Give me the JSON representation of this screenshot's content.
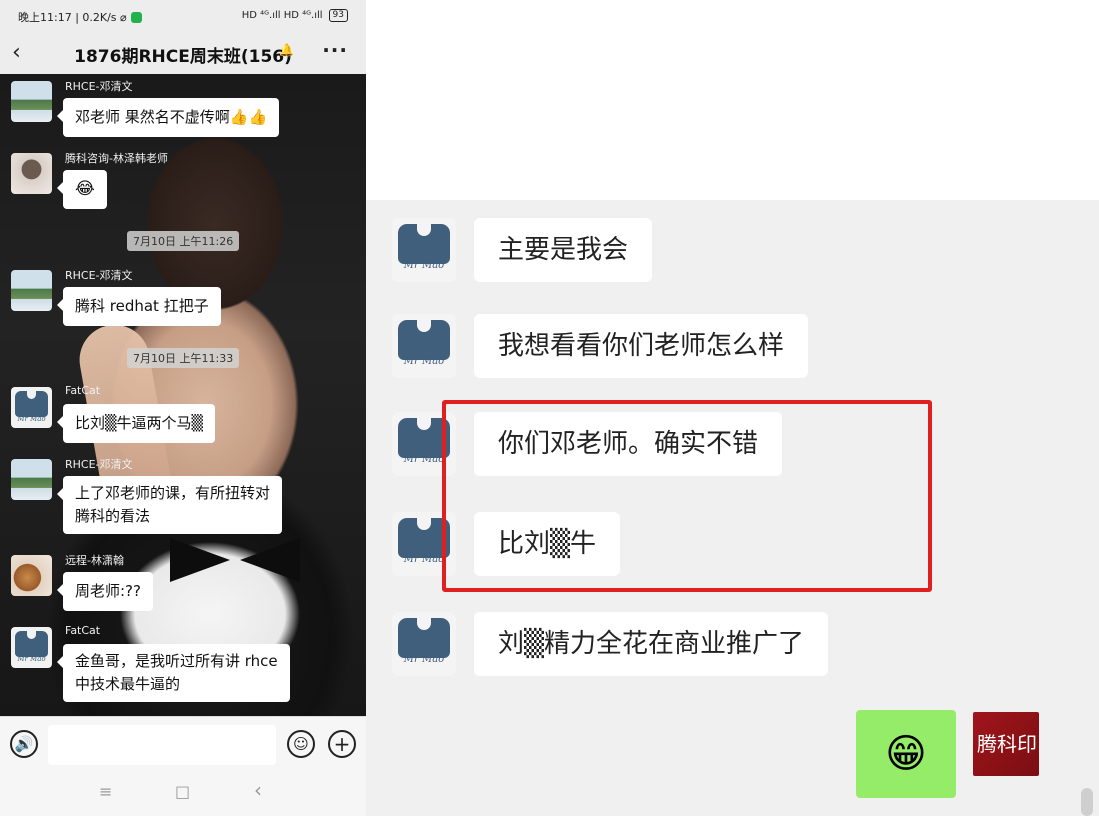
{
  "status_bar": {
    "time_speed": "晚上11:17 | 0.2K/s ⌀",
    "signals": "HD ⁴ᴳ.ıll HD ⁴ᴳ.ıll",
    "battery": "93"
  },
  "header": {
    "title": "1876期RHCE周末班(156)",
    "back_icon": "‹",
    "mute_icon": "🔔",
    "more_icon": "···"
  },
  "left_chat": {
    "messages": [
      {
        "sender": "RHCE-邓清文",
        "text": "邓老师 果然名不虚传啊👍👍"
      },
      {
        "sender": "腾科咨询-林泽韩老师",
        "text": "😂"
      },
      {
        "sender": "RHCE-邓清文",
        "text": "腾科 redhat 扛把子"
      },
      {
        "sender": "FatCat",
        "text": "比刘▒牛逼两个马▒"
      },
      {
        "sender": "RHCE-邓清文",
        "text": "上了邓老师的课，有所扭转对",
        "text2": "腾科的看法"
      },
      {
        "sender": "远程-林潇翰",
        "text": "周老师:??"
      },
      {
        "sender": "FatCat",
        "text": "金鱼哥，是我听过所有讲 rhce",
        "text2": "中技术最牛逼的"
      }
    ],
    "timestamps": [
      "7月10日 上午11:26",
      "7月10日 上午11:33"
    ],
    "avatar_caption": "Mr Mao"
  },
  "input_bar": {
    "voice_icon": "🔊",
    "emoji_icon": "☺",
    "plus_icon": "+"
  },
  "nav_bar": {
    "menu_icon": "≡",
    "home_icon": "□",
    "back_icon": "‹"
  },
  "zoom_chat": {
    "messages": [
      "主要是我会",
      "我想看看你们老师怎么样",
      "你们邓老师。确实不错",
      "比刘▒牛",
      "刘▒精力全花在商业推广了"
    ],
    "avatar_caption": "Mr Mao",
    "sent_emoji": "😁",
    "self_avatar_text": "腾科印",
    "highlight_color": "#e02020"
  }
}
